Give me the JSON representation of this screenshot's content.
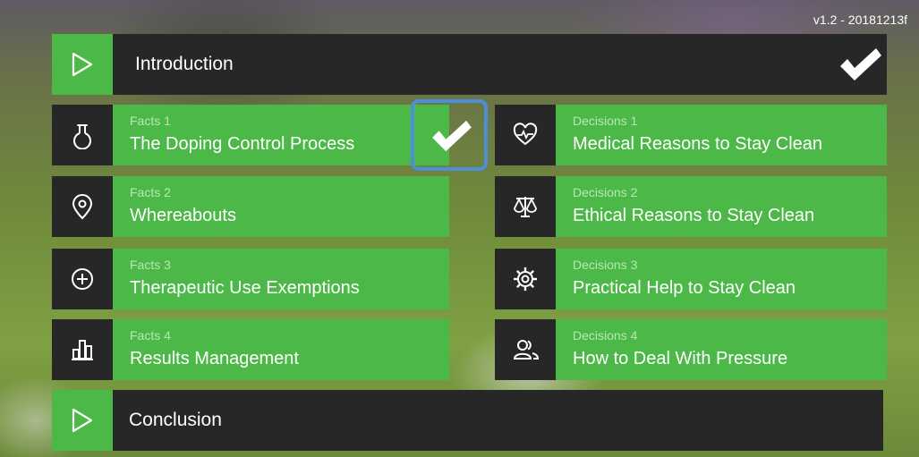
{
  "version": "v1.2 - 20181213f",
  "intro": {
    "title": "Introduction",
    "completed": true
  },
  "conclusion": {
    "title": "Conclusion",
    "completed": false
  },
  "facts": [
    {
      "sub": "Facts 1",
      "title": "The Doping Control Process",
      "icon": "flask-icon",
      "completed": true
    },
    {
      "sub": "Facts 2",
      "title": "Whereabouts",
      "icon": "location-pin-icon",
      "completed": false
    },
    {
      "sub": "Facts 3",
      "title": "Therapeutic Use Exemptions",
      "icon": "plus-circle-icon",
      "completed": false
    },
    {
      "sub": "Facts 4",
      "title": "Results Management",
      "icon": "bar-chart-icon",
      "completed": false
    }
  ],
  "decisions": [
    {
      "sub": "Decisions 1",
      "title": "Medical Reasons to Stay Clean",
      "icon": "heart-pulse-icon"
    },
    {
      "sub": "Decisions 2",
      "title": "Ethical Reasons to Stay Clean",
      "icon": "scales-icon"
    },
    {
      "sub": "Decisions 3",
      "title": "Practical Help to Stay Clean",
      "icon": "gear-icon"
    },
    {
      "sub": "Decisions 4",
      "title": "How to Deal With Pressure",
      "icon": "people-icon"
    }
  ],
  "colors": {
    "accent_green": "#4cb848",
    "dark_panel": "#272727",
    "focus_ring": "#4b8fd6",
    "subtitle_text": "#b9e7b0"
  }
}
